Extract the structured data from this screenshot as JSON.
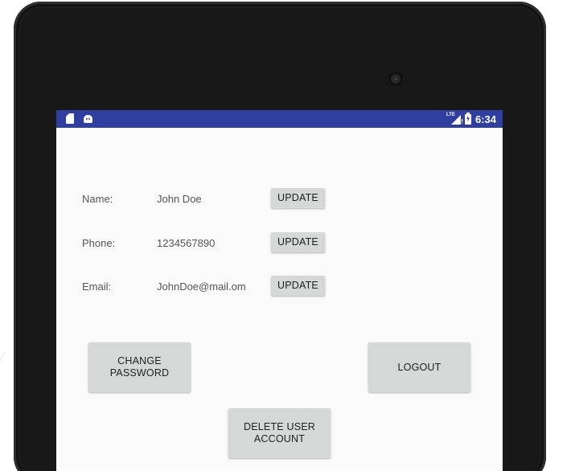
{
  "status_bar": {
    "time": "6:34",
    "network_label": "LTE",
    "left_icons": [
      "sd-card-icon",
      "android-debug-icon"
    ],
    "right_icons": [
      "signal-icon",
      "battery-icon"
    ],
    "color": "#303f9f"
  },
  "profile": {
    "rows": [
      {
        "label": "Name:",
        "value": "John Doe",
        "button": "UPDATE"
      },
      {
        "label": "Phone:",
        "value": "1234567890",
        "button": "UPDATE"
      },
      {
        "label": "Email:",
        "value": "JohnDoe@mail.om",
        "button": "UPDATE"
      }
    ]
  },
  "actions": {
    "change_password_line1": "CHANGE",
    "change_password_line2": "PASSWORD",
    "logout": "LOGOUT",
    "delete_account_line1": "DELETE USER",
    "delete_account_line2": "ACCOUNT"
  }
}
